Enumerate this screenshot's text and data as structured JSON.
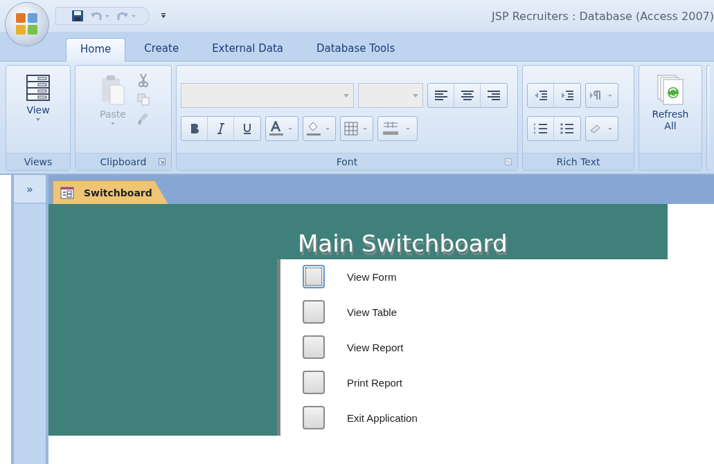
{
  "window": {
    "title": "JSP Recruiters : Database (Access 2007)"
  },
  "ribbon_tabs": [
    {
      "label": "Home",
      "selected": true
    },
    {
      "label": "Create",
      "selected": false
    },
    {
      "label": "External Data",
      "selected": false
    },
    {
      "label": "Database Tools",
      "selected": false
    }
  ],
  "ribbon": {
    "views": {
      "label": "Views",
      "view_button": "View"
    },
    "clipboard": {
      "label": "Clipboard",
      "paste_button": "Paste",
      "paste_disabled": true
    },
    "font": {
      "label": "Font"
    },
    "rich_text": {
      "label": "Rich Text"
    },
    "records": {
      "refresh_button": "Refresh All"
    }
  },
  "nav_pane": {
    "toggle": "»"
  },
  "document_tabs": [
    {
      "label": "Switchboard",
      "selected": true
    }
  ],
  "form": {
    "title": "Main Switchboard",
    "items": [
      {
        "label": "View Form",
        "selected": true
      },
      {
        "label": "View Table",
        "selected": false
      },
      {
        "label": "View Report",
        "selected": false
      },
      {
        "label": "Print Report",
        "selected": false
      },
      {
        "label": "Exit Application",
        "selected": false
      }
    ]
  }
}
